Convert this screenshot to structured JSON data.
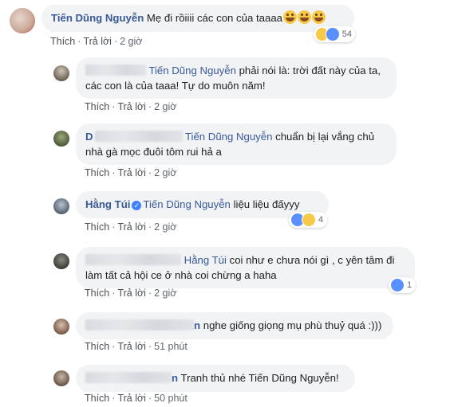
{
  "comments": [
    {
      "author": "Tiến Dũng Nguyễn",
      "text": "Mẹ đi rồiiii các con của taaaa",
      "actions": {
        "like": "Thích",
        "reply": "Trả lời",
        "time": "2 giờ"
      },
      "reaction_count": "54"
    },
    {
      "mention": "Tiến Dũng Nguyễn",
      "text": "phải nói là: trời đất này của ta, các con là của taaa! Tự do muôn năm!",
      "actions": {
        "like": "Thích",
        "reply": "Trả lời",
        "time": "2 giờ"
      }
    },
    {
      "author_initial": "D",
      "mention": "Tiến Dũng Nguyễn",
      "text": "chuẩn bị lại vắng chủ nhà gà mọc đuôi tôm rui hả a",
      "actions": {
        "like": "Thích",
        "reply": "Trả lời",
        "time": "2 giờ"
      }
    },
    {
      "author": "Hằng Túi",
      "verified_icon": "check",
      "mention": "Tiến Dũng Nguyễn",
      "text": "liệu liệu đấyyy",
      "actions": {
        "like": "Thích",
        "reply": "Trả lời",
        "time": "2 giờ"
      },
      "reaction_count": "4"
    },
    {
      "mention": "Hằng Túi",
      "text": "coi như e chưa nói gì , c yên tâm đi làm tất cả hội ce ở nhà coi chừng a haha",
      "actions": {
        "like": "Thích",
        "reply": "Trả lời",
        "time": "2 giờ"
      },
      "reaction_count": "1"
    },
    {
      "author_tail": "n",
      "text": "nghe giống giọng mụ phù thuỷ quá :)))",
      "actions": {
        "like": "Thích",
        "reply": "Trả lời",
        "time": "51 phút"
      }
    },
    {
      "author_tail": "n",
      "text": "Tranh thủ nhé Tiến Dũng Nguyễn!",
      "actions": {
        "like": "Thích",
        "reply": "Trả lời",
        "time": "50 phút"
      }
    }
  ],
  "colors": {
    "name": "#385898",
    "bubble": "#f2f3f5",
    "like": "#5890ff",
    "haha": "#f7c948"
  }
}
